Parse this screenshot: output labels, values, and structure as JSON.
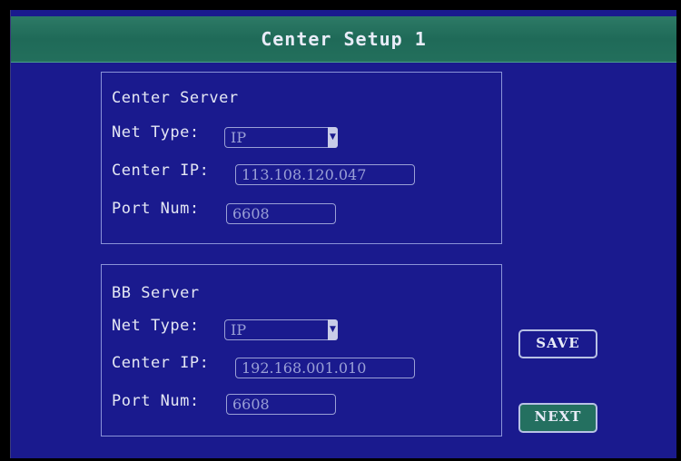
{
  "window": {
    "title": "Center Setup 1"
  },
  "center_server": {
    "heading": "Center Server",
    "net_type_label": "Net Type:",
    "net_type_value": "IP",
    "center_ip_label": "Center IP:",
    "center_ip_value": "113.108.120.047",
    "port_label": "Port Num:",
    "port_value": "6608"
  },
  "bb_server": {
    "heading": "BB Server",
    "net_type_label": "Net Type:",
    "net_type_value": "IP",
    "center_ip_label": "Center IP:",
    "center_ip_value": "192.168.001.010",
    "port_label": "Port Num:",
    "port_value": "6608"
  },
  "buttons": {
    "save": "SAVE",
    "next": "NEXT"
  },
  "icons": {
    "dropdown": "chevron-down-icon"
  },
  "colors": {
    "background": "#1a1a8e",
    "titlebar": "#1f6a58",
    "field_border": "#9aa0d6"
  }
}
